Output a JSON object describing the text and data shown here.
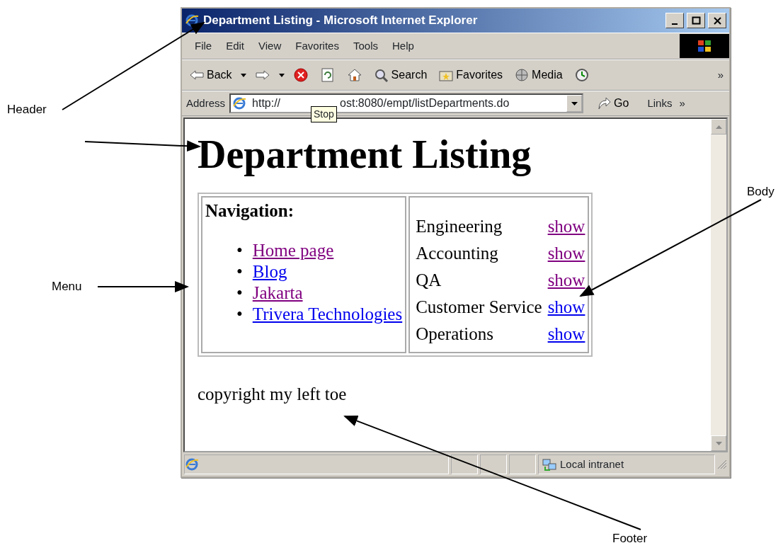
{
  "window": {
    "title": "Department Listing - Microsoft Internet Explorer"
  },
  "menu": [
    "File",
    "Edit",
    "View",
    "Favorites",
    "Tools",
    "Help"
  ],
  "toolbar": [
    {
      "kind": "back",
      "label": "Back"
    },
    {
      "kind": "forward"
    },
    {
      "kind": "stop"
    },
    {
      "kind": "refresh"
    },
    {
      "kind": "home"
    },
    {
      "kind": "search",
      "label": "Search"
    },
    {
      "kind": "favorites",
      "label": "Favorites"
    },
    {
      "kind": "media",
      "label": "Media"
    },
    {
      "kind": "history"
    }
  ],
  "toolbar_more": "»",
  "address": {
    "label": "Address",
    "url_start": "http://",
    "url_end": "ost:8080/empt/listDepartments.do",
    "go": "Go",
    "links": "Links",
    "links_more": "»"
  },
  "tooltip": "Stop",
  "page": {
    "heading": "Department Listing",
    "navigation": {
      "title": "Navigation:",
      "links": [
        {
          "bullet": "•",
          "text": "Home page",
          "visited": true
        },
        {
          "bullet": "•",
          "text": "Blog",
          "visited": false
        },
        {
          "bullet": "•",
          "text": "Jakarta",
          "visited": true
        },
        {
          "bullet": "•",
          "text": "Trivera Technologies",
          "visited": false
        }
      ]
    },
    "departments": [
      {
        "name": "Engineering",
        "action": "show",
        "visited": true
      },
      {
        "name": "Accounting",
        "action": "show",
        "visited": true
      },
      {
        "name": "QA",
        "action": "show",
        "visited": true
      },
      {
        "name": "Customer Service",
        "action": "show",
        "visited": false
      },
      {
        "name": "Operations",
        "action": "show",
        "visited": false
      }
    ],
    "footer": "copyright my left toe"
  },
  "status_bar": {
    "zone": "Local intranet"
  },
  "annotations": [
    "Header",
    "Menu",
    "Body",
    "Footer"
  ]
}
